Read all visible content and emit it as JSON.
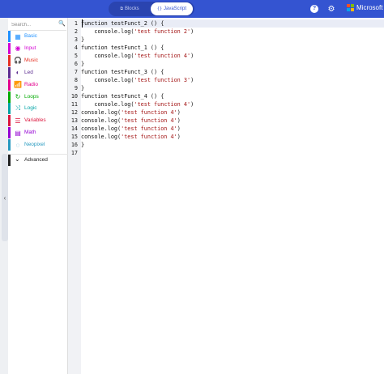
{
  "header": {
    "tabs": [
      {
        "label": "Blocks",
        "icon": "puzzle-icon"
      },
      {
        "label": "JavaScript",
        "icon": "code-brackets-icon"
      }
    ],
    "active_tab": "JavaScript",
    "help_icon": "help-icon",
    "settings_icon": "gear-icon",
    "brand": "Microsoft",
    "colors": {
      "header_bg": "#3454d1",
      "ms_red": "#f25022",
      "ms_green": "#7fba00",
      "ms_blue": "#00a4ef",
      "ms_yellow": "#ffb900"
    }
  },
  "sidebar": {
    "search": {
      "placeholder": "Search..."
    },
    "categories": [
      {
        "label": "Basic",
        "color": "#1e90ff",
        "icon": "grid-icon"
      },
      {
        "label": "Input",
        "color": "#d400d4",
        "icon": "target-icon"
      },
      {
        "label": "Music",
        "color": "#e63022",
        "icon": "headphones-icon"
      },
      {
        "label": "Led",
        "color": "#5c2d91",
        "icon": "toggle-icon"
      },
      {
        "label": "Radio",
        "color": "#e3008c",
        "icon": "signal-icon"
      },
      {
        "label": "Loops",
        "color": "#00aa00",
        "icon": "refresh-icon"
      },
      {
        "label": "Logic",
        "color": "#00a4a6",
        "icon": "shuffle-icon"
      },
      {
        "label": "Variables",
        "color": "#dc143c",
        "icon": "list-icon"
      },
      {
        "label": "Math",
        "color": "#9400d3",
        "icon": "calculator-icon"
      },
      {
        "label": "Neopixel",
        "color": "#2699bf",
        "icon": "ring-icon"
      }
    ],
    "advanced": {
      "label": "Advanced",
      "icon": "chevron-down-icon"
    }
  },
  "editor": {
    "lines": [
      {
        "n": "1",
        "code": "function testFunct_2 () {",
        "str": ""
      },
      {
        "n": "2",
        "code": "    console.log(",
        "str": "'test function 2'",
        "tail": ")"
      },
      {
        "n": "3",
        "code": "}",
        "str": ""
      },
      {
        "n": "4",
        "code": "function testFunct_1 () {",
        "str": ""
      },
      {
        "n": "5",
        "code": "    console.log(",
        "str": "'test function 4'",
        "tail": ")"
      },
      {
        "n": "6",
        "code": "}",
        "str": ""
      },
      {
        "n": "7",
        "code": "function testFunct_3 () {",
        "str": ""
      },
      {
        "n": "8",
        "code": "    console.log(",
        "str": "'test function 3'",
        "tail": ")"
      },
      {
        "n": "9",
        "code": "}",
        "str": ""
      },
      {
        "n": "10",
        "code": "function testFunct_4 () {",
        "str": ""
      },
      {
        "n": "11",
        "code": "    console.log(",
        "str": "'test function 4'",
        "tail": ")"
      },
      {
        "n": "12",
        "code": "console.log(",
        "str": "'test function 4'",
        "tail": ")"
      },
      {
        "n": "13",
        "code": "console.log(",
        "str": "'test function 4'",
        "tail": ")"
      },
      {
        "n": "14",
        "code": "console.log(",
        "str": "'test function 4'",
        "tail": ")"
      },
      {
        "n": "15",
        "code": "console.log(",
        "str": "'test function 4'",
        "tail": ")"
      },
      {
        "n": "16",
        "code": "}",
        "str": ""
      },
      {
        "n": "17",
        "code": "",
        "str": ""
      }
    ]
  }
}
